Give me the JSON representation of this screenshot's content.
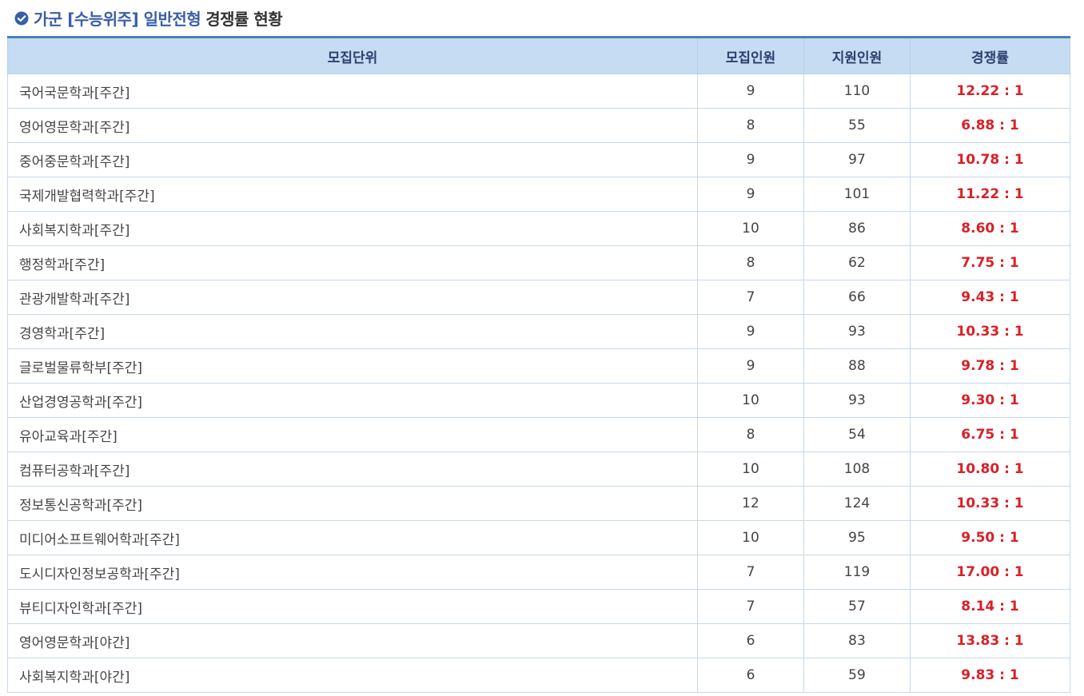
{
  "title": {
    "accent": "가군 [수능위주] 일반전형",
    "rest": "경쟁률 현황",
    "icon": "check-circle-icon",
    "accent_color": "#3a5ea8"
  },
  "table": {
    "headers": [
      "모집단위",
      "모집인원",
      "지원인원",
      "경쟁률"
    ],
    "header_bg": "#c6dcf3",
    "rate_color": "#d92027",
    "rows": [
      {
        "unit": "국어국문학과[주간]",
        "quota": "9",
        "applicants": "110",
        "rate": "12.22 : 1"
      },
      {
        "unit": "영어영문학과[주간]",
        "quota": "8",
        "applicants": "55",
        "rate": "6.88 : 1"
      },
      {
        "unit": "중어중문학과[주간]",
        "quota": "9",
        "applicants": "97",
        "rate": "10.78 : 1"
      },
      {
        "unit": "국제개발협력학과[주간]",
        "quota": "9",
        "applicants": "101",
        "rate": "11.22 : 1"
      },
      {
        "unit": "사회복지학과[주간]",
        "quota": "10",
        "applicants": "86",
        "rate": "8.60 : 1"
      },
      {
        "unit": "행정학과[주간]",
        "quota": "8",
        "applicants": "62",
        "rate": "7.75 : 1"
      },
      {
        "unit": "관광개발학과[주간]",
        "quota": "7",
        "applicants": "66",
        "rate": "9.43 : 1"
      },
      {
        "unit": "경영학과[주간]",
        "quota": "9",
        "applicants": "93",
        "rate": "10.33 : 1"
      },
      {
        "unit": "글로벌물류학부[주간]",
        "quota": "9",
        "applicants": "88",
        "rate": "9.78 : 1"
      },
      {
        "unit": "산업경영공학과[주간]",
        "quota": "10",
        "applicants": "93",
        "rate": "9.30 : 1"
      },
      {
        "unit": "유아교육과[주간]",
        "quota": "8",
        "applicants": "54",
        "rate": "6.75 : 1"
      },
      {
        "unit": "컴퓨터공학과[주간]",
        "quota": "10",
        "applicants": "108",
        "rate": "10.80 : 1"
      },
      {
        "unit": "정보통신공학과[주간]",
        "quota": "12",
        "applicants": "124",
        "rate": "10.33 : 1"
      },
      {
        "unit": "미디어소프트웨어학과[주간]",
        "quota": "10",
        "applicants": "95",
        "rate": "9.50 : 1"
      },
      {
        "unit": "도시디자인정보공학과[주간]",
        "quota": "7",
        "applicants": "119",
        "rate": "17.00 : 1"
      },
      {
        "unit": "뷰티디자인학과[주간]",
        "quota": "7",
        "applicants": "57",
        "rate": "8.14 : 1"
      },
      {
        "unit": "영어영문학과[야간]",
        "quota": "6",
        "applicants": "83",
        "rate": "13.83 : 1"
      },
      {
        "unit": "사회복지학과[야간]",
        "quota": "6",
        "applicants": "59",
        "rate": "9.83 : 1"
      }
    ]
  }
}
